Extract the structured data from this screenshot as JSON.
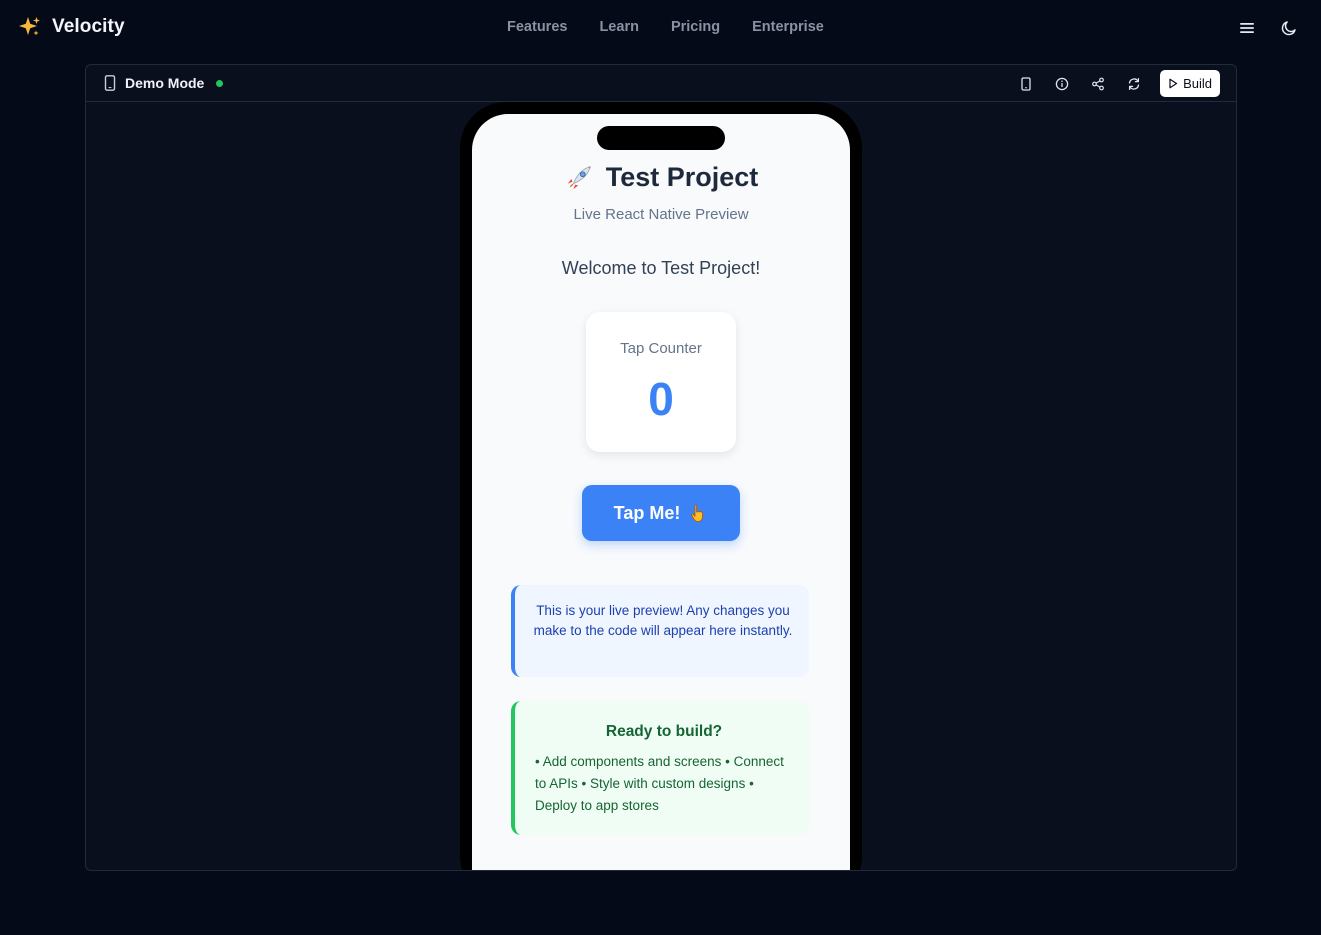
{
  "nav": {
    "brand": "Velocity",
    "brand_icon": "sparkles-icon",
    "links": [
      "Features",
      "Learn",
      "Pricing",
      "Enterprise"
    ],
    "right_icons": [
      "menu-icon",
      "moon-icon"
    ]
  },
  "preview_panel": {
    "mode_label": "Demo Mode",
    "mode_icon": "phone-icon",
    "status_color": "#22c55e",
    "tools": [
      "device-icon",
      "info-icon",
      "share-icon",
      "refresh-icon"
    ],
    "build_label": "Build"
  },
  "app": {
    "title": "Test Project",
    "title_icon": "rocket-icon",
    "subtitle": "Live React Native Preview",
    "welcome": "Welcome to Test Project!",
    "counter_label": "Tap Counter",
    "counter_value": "0",
    "tap_button": "Tap Me!",
    "tap_button_icon": "pointing-hand-icon",
    "info_text": "This is your live preview! Any changes you make to the code will appear here instantly.",
    "ready_title": "Ready to build?",
    "ready_text": "• Add components and screens • Connect to APIs • Style with custom designs • Deploy to app stores"
  },
  "colors": {
    "background": "#050a18",
    "accent_blue": "#3b82f6",
    "success_green": "#22c55e"
  }
}
